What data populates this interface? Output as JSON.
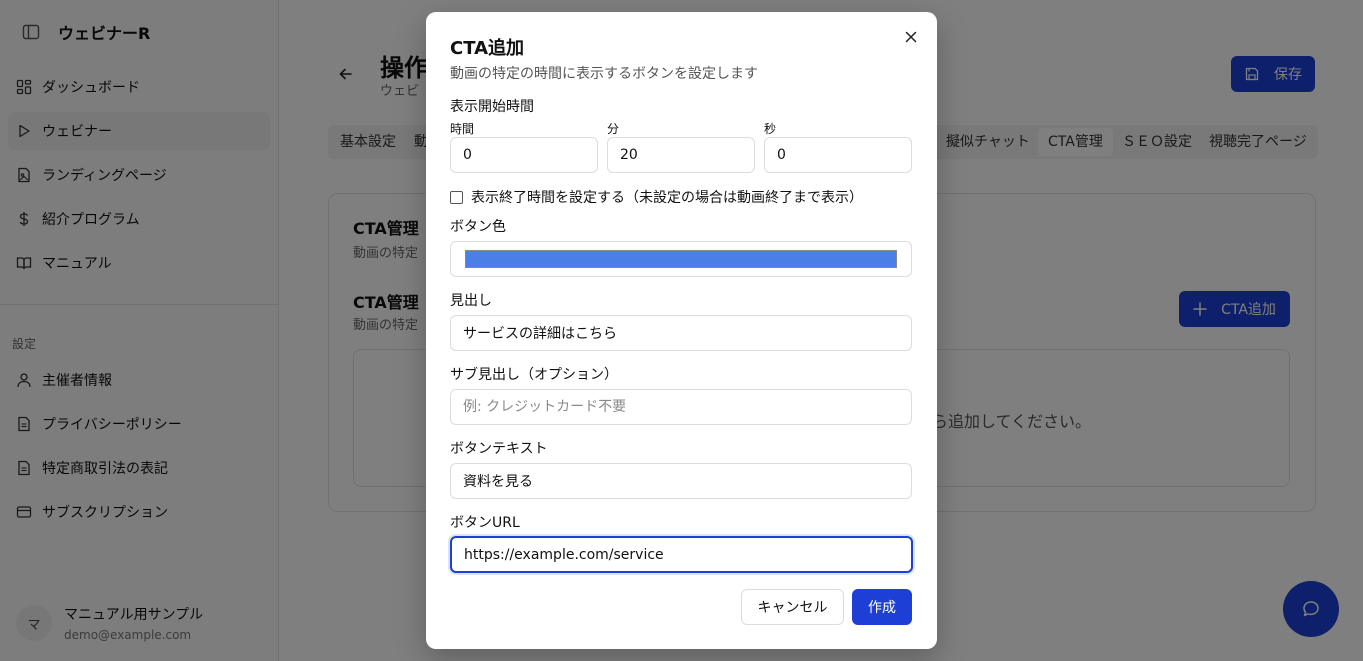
{
  "sidebar": {
    "brand": "ウェビナーR",
    "items": [
      {
        "label": "ダッシュボード"
      },
      {
        "label": "ウェビナー"
      },
      {
        "label": "ランディングページ"
      },
      {
        "label": "紹介プログラム"
      },
      {
        "label": "マニュアル"
      }
    ],
    "section_label": "設定",
    "settings_items": [
      {
        "label": "主催者情報"
      },
      {
        "label": "プライバシーポリシー"
      },
      {
        "label": "特定商取引法の表記"
      },
      {
        "label": "サブスクリプション"
      }
    ],
    "user": {
      "avatar": "マ",
      "name": "マニュアル用サンプル",
      "email": "demo@example.com"
    }
  },
  "main": {
    "title": "操作",
    "subtitle": "ウェビ",
    "save_label": "保存",
    "tabs": [
      {
        "label": "基本設定"
      },
      {
        "label": "動"
      },
      {
        "label": "擬似チャット"
      },
      {
        "label": "CTA管理"
      },
      {
        "label": "ＳＥＯ設定"
      },
      {
        "label": "視聴完了ページ"
      }
    ],
    "card1_title": "CTA管理",
    "card1_sub": "動画の特定",
    "card2_title": "CTA管理",
    "card2_sub": "動画の特定",
    "add_label": "CTA追加",
    "empty_text": "ら追加してください。"
  },
  "modal": {
    "title": "CTA追加",
    "description": "動画の特定の時間に表示するボタンを設定します",
    "start_time_label": "表示開始時間",
    "hours_label": "時間",
    "minutes_label": "分",
    "seconds_label": "秒",
    "hours_value": "0",
    "minutes_value": "20",
    "seconds_value": "0",
    "end_time_checkbox_label": "表示終了時間を設定する（未設定の場合は動画終了まで表示）",
    "end_time_checked": false,
    "button_color_label": "ボタン色",
    "button_color": "#4a7fe6",
    "headline_label": "見出し",
    "headline_value": "サービスの詳細はこちら",
    "subheadline_label": "サブ見出し（オプション）",
    "subheadline_placeholder": "例: クレジットカード不要",
    "button_text_label": "ボタンテキスト",
    "button_text_value": "資料を見る",
    "button_url_label": "ボタンURL",
    "button_url_value": "https://example.com/service",
    "cancel_label": "キャンセル",
    "create_label": "作成"
  }
}
